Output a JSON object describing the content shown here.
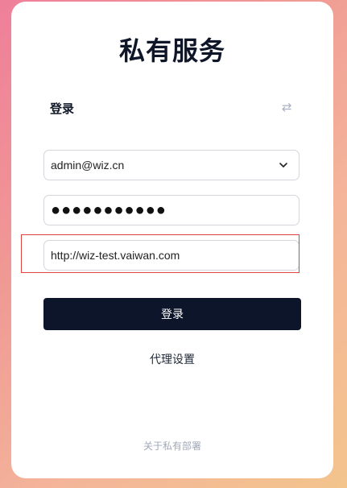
{
  "title": "私有服务",
  "login": {
    "header": "登录",
    "switch_icon": "swap-arrows-icon",
    "account": {
      "value": "admin@wiz.cn",
      "icon": "chevron-down-icon"
    },
    "password": {
      "masked_value": "●●●●●●●●●●●"
    },
    "server_url": {
      "value": "http://wiz-test.vaiwan.com"
    },
    "submit_label": "登录",
    "proxy_settings_label": "代理设置"
  },
  "footer": {
    "about_label": "关于私有部署"
  },
  "colors": {
    "button_bg": "#0c1529",
    "highlight_border": "#e0433c",
    "title": "#0f1628"
  }
}
